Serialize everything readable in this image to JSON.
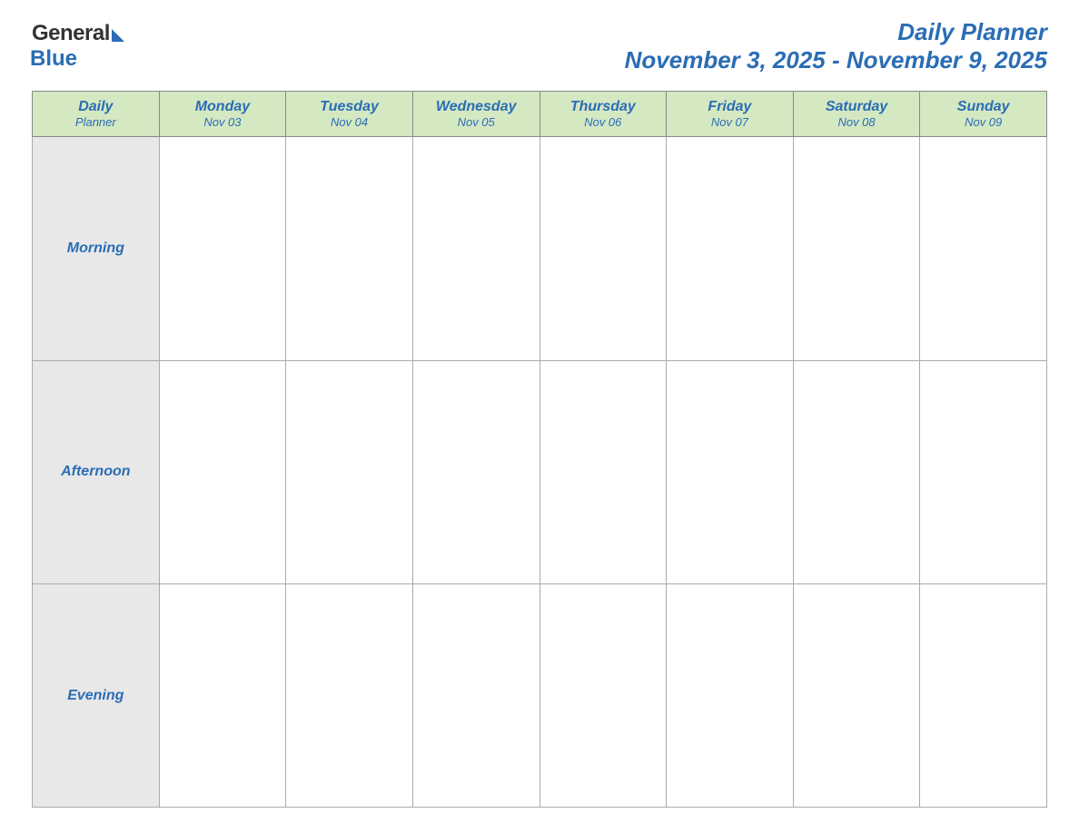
{
  "header": {
    "logo": {
      "word1": "General",
      "word2": "Blue"
    },
    "title": "Daily Planner",
    "date_range": "November 3, 2025 - November 9, 2025"
  },
  "table": {
    "header_col_label": "Daily",
    "header_col_label2": "Planner",
    "days": [
      {
        "name": "Monday",
        "date": "Nov 03"
      },
      {
        "name": "Tuesday",
        "date": "Nov 04"
      },
      {
        "name": "Wednesday",
        "date": "Nov 05"
      },
      {
        "name": "Thursday",
        "date": "Nov 06"
      },
      {
        "name": "Friday",
        "date": "Nov 07"
      },
      {
        "name": "Saturday",
        "date": "Nov 08"
      },
      {
        "name": "Sunday",
        "date": "Nov 09"
      }
    ],
    "rows": [
      {
        "label": "Morning"
      },
      {
        "label": "Afternoon"
      },
      {
        "label": "Evening"
      }
    ]
  }
}
